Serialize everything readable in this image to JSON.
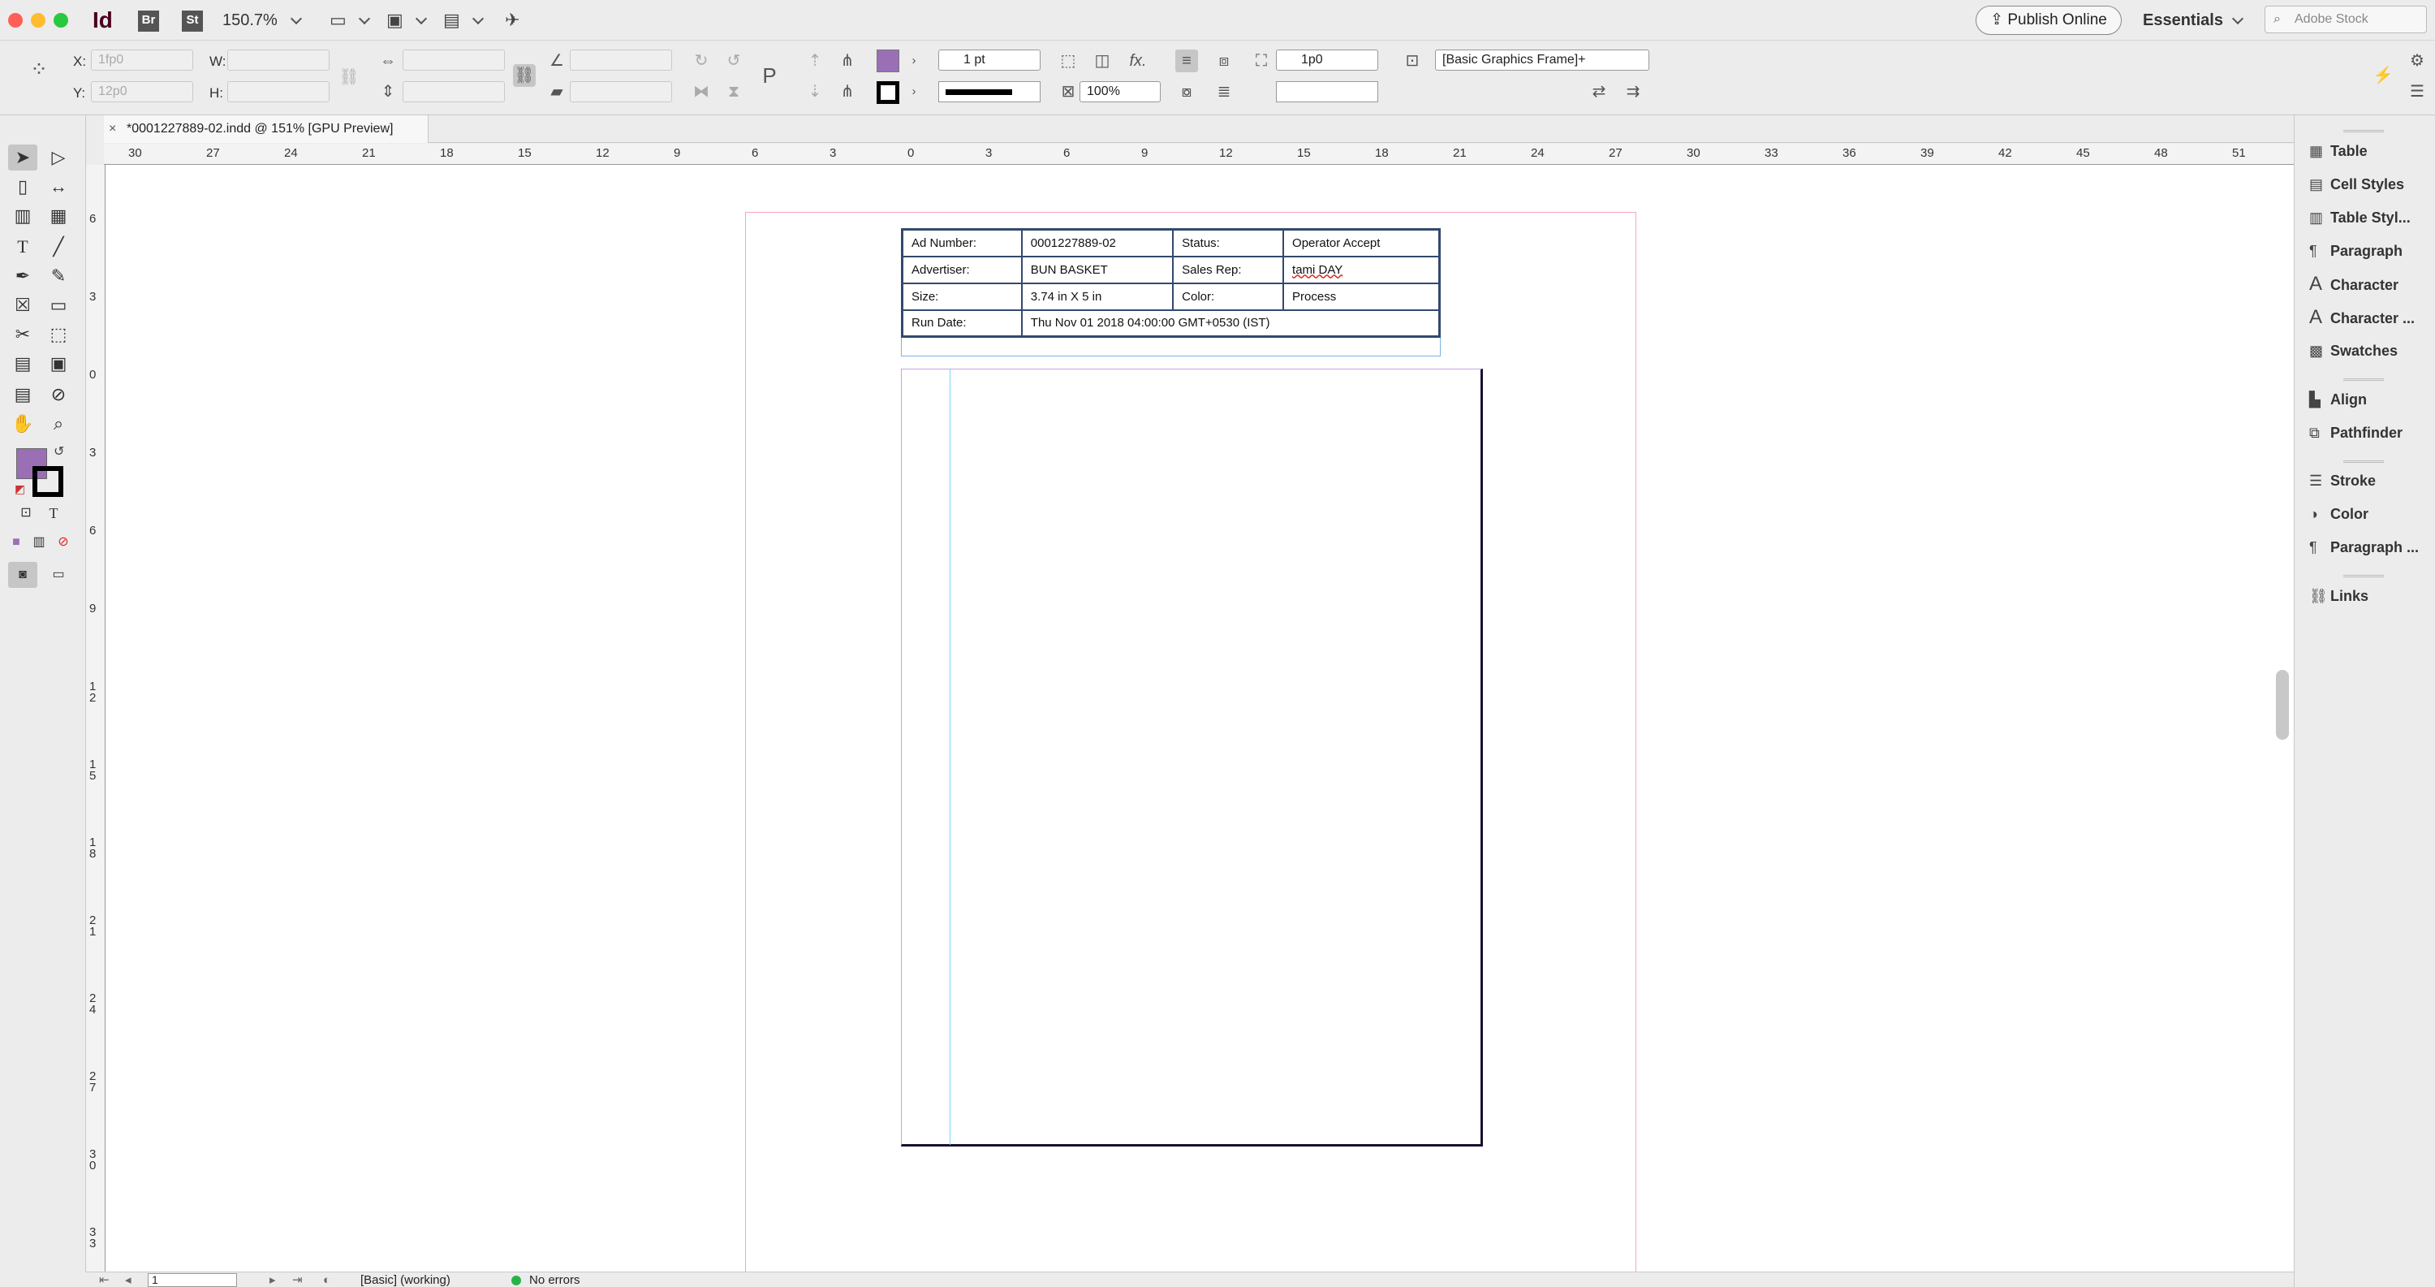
{
  "titlebar": {
    "app": "Id",
    "bridge": "Br",
    "stock": "St",
    "zoom": "150.7%",
    "publish": "Publish Online",
    "workspace": "Essentials",
    "search_placeholder": "Adobe Stock"
  },
  "control": {
    "x_label": "X:",
    "y_label": "Y:",
    "w_label": "W:",
    "h_label": "H:",
    "x_val": "1fp0",
    "y_val": "12p0",
    "stroke_weight": "1 pt",
    "scale": "100%",
    "offset": "1p0",
    "object_style": "[Basic Graphics Frame]+",
    "fill_color": "#9b6fb5",
    "fx": "fx."
  },
  "document": {
    "tab_title": "*0001227889-02.indd @ 151% [GPU Preview]"
  },
  "ruler": {
    "h_ticks": [
      "30",
      "27",
      "24",
      "21",
      "18",
      "15",
      "12",
      "9",
      "6",
      "3",
      "0",
      "3",
      "6",
      "9",
      "12",
      "15",
      "18",
      "21",
      "24",
      "27",
      "30",
      "33",
      "36",
      "39",
      "42",
      "45",
      "48",
      "51"
    ],
    "v_ticks": [
      "6",
      "3",
      "0",
      "3",
      "6",
      "9",
      "12",
      "15",
      "18",
      "21",
      "24",
      "27",
      "30",
      "33"
    ]
  },
  "ad_info": {
    "rows": [
      [
        "Ad Number:",
        "0001227889-02",
        "Status:",
        "Operator Accept"
      ],
      [
        "Advertiser:",
        "BUN BASKET",
        "Sales Rep:",
        "tami DAY"
      ],
      [
        "Size:",
        "3.74 in X 5 in",
        "Color:",
        "Process"
      ]
    ],
    "run_label": "Run Date:",
    "run_value": "Thu Nov 01 2018 04:00:00 GMT+0530 (IST)"
  },
  "status": {
    "page": "1",
    "preflight_profile": "[Basic] (working)",
    "errors": "No errors"
  },
  "panels": [
    {
      "icon": "table-icon",
      "label": "Table"
    },
    {
      "icon": "cell-styles-icon",
      "label": "Cell Styles"
    },
    {
      "icon": "table-styles-icon",
      "label": "Table Styl..."
    },
    {
      "icon": "paragraph-icon",
      "label": "Paragraph"
    },
    {
      "icon": "character-icon",
      "label": "Character"
    },
    {
      "icon": "character-styles-icon",
      "label": "Character ..."
    },
    {
      "icon": "swatches-icon",
      "label": "Swatches"
    },
    {
      "icon": "align-icon",
      "label": "Align"
    },
    {
      "icon": "pathfinder-icon",
      "label": "Pathfinder"
    },
    {
      "icon": "stroke-icon",
      "label": "Stroke"
    },
    {
      "icon": "color-icon",
      "label": "Color"
    },
    {
      "icon": "paragraph-styles-icon",
      "label": "Paragraph ..."
    },
    {
      "icon": "links-icon",
      "label": "Links"
    }
  ]
}
